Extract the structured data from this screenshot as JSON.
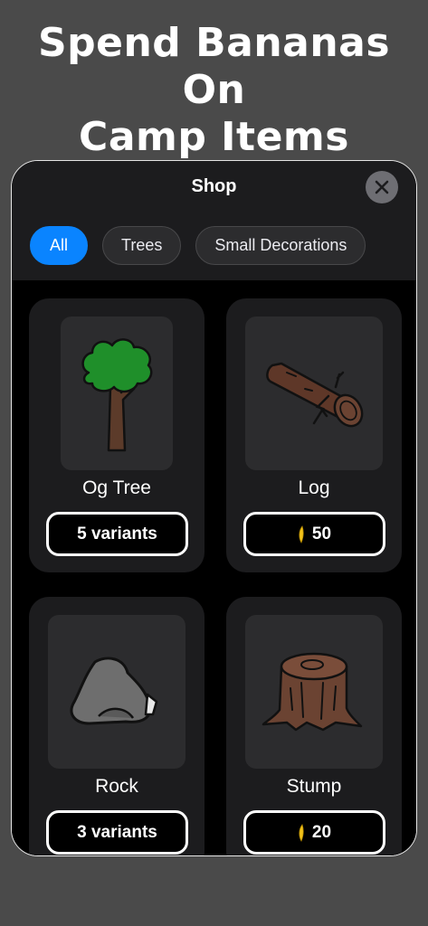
{
  "headline": {
    "line1": "Spend Bananas On",
    "line2": "Camp Items"
  },
  "sheet": {
    "title": "Shop",
    "close_icon": "close-x-icon"
  },
  "tabs": [
    {
      "label": "All",
      "active": true
    },
    {
      "label": "Trees",
      "active": false
    },
    {
      "label": "Small Decorations",
      "active": false
    }
  ],
  "items": [
    {
      "name": "Og Tree",
      "price_label": "5 variants",
      "icon": "tree-icon"
    },
    {
      "name": "Log",
      "price_label": "50",
      "icon": "log-icon",
      "currency_icon": "banana-icon"
    },
    {
      "name": "Rock",
      "price_label": "3 variants",
      "icon": "rock-icon"
    },
    {
      "name": "Stump",
      "price_label": "20",
      "icon": "stump-icon",
      "currency_icon": "banana-icon"
    }
  ],
  "colors": {
    "accent": "#0a84ff",
    "background": "#4a4a4a",
    "sheet": "#1c1c1e",
    "banana": "#f2c21b"
  }
}
